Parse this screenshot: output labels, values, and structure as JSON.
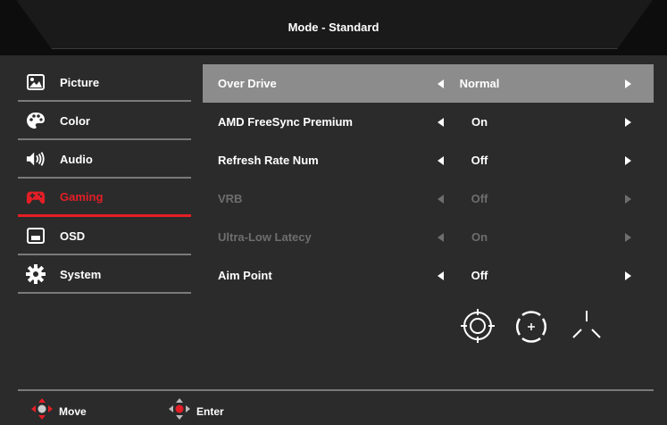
{
  "header": {
    "title": "Mode - Standard"
  },
  "sidebar": {
    "items": [
      {
        "label": "Picture",
        "icon": "picture-icon"
      },
      {
        "label": "Color",
        "icon": "palette-icon"
      },
      {
        "label": "Audio",
        "icon": "speaker-icon"
      },
      {
        "label": "Gaming",
        "icon": "gamepad-icon",
        "active": true
      },
      {
        "label": "OSD",
        "icon": "osd-icon"
      },
      {
        "label": "System",
        "icon": "gear-icon"
      }
    ]
  },
  "settings": {
    "rows": [
      {
        "name": "Over Drive",
        "value": "Normal",
        "selected": true,
        "enabled": true
      },
      {
        "name": "AMD FreeSync Premium",
        "value": "On",
        "enabled": true
      },
      {
        "name": "Refresh Rate Num",
        "value": "Off",
        "enabled": true
      },
      {
        "name": "VRB",
        "value": "Off",
        "enabled": false
      },
      {
        "name": "Ultra-Low Latecy",
        "value": "On",
        "enabled": false
      },
      {
        "name": "Aim Point",
        "value": "Off",
        "enabled": true
      }
    ]
  },
  "aim_point_icons": [
    "aim-point-circle-icon",
    "aim-point-dot-icon",
    "aim-point-tri-icon"
  ],
  "footer": {
    "move_label": "Move",
    "enter_label": "Enter"
  },
  "colors": {
    "accent": "#e41e26",
    "selected_row": "#8c8c8c",
    "background": "#2b2b2b",
    "disabled": "#6e6e6e"
  }
}
